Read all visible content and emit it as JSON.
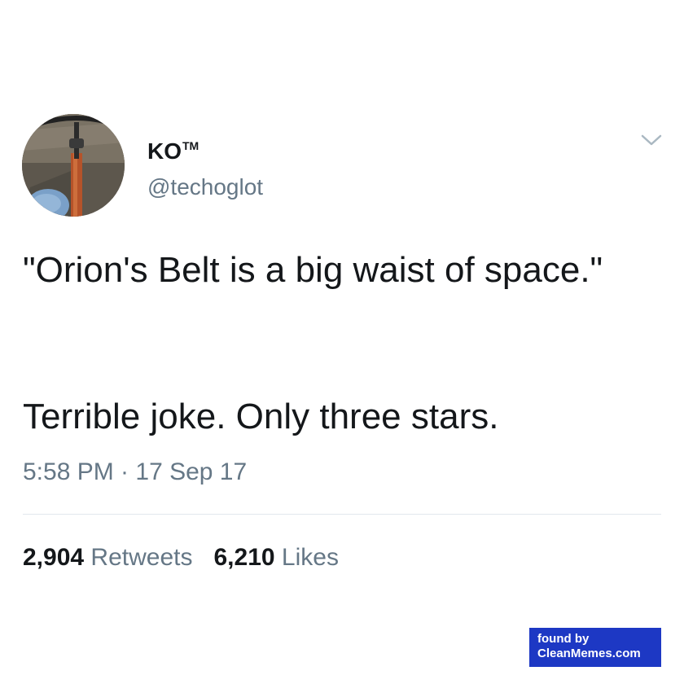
{
  "tweet": {
    "author": {
      "display_name": "KO",
      "trademark": "TM",
      "handle": "@techoglot",
      "avatar_icon": "bicycle-photo-avatar"
    },
    "menu_icon": "chevron-down-icon",
    "text": {
      "line1": "\"Orion's Belt is a big waist of space.\"",
      "line2": "Terrible joke. Only three stars."
    },
    "timestamp": "5:58 PM · 17 Sep 17",
    "stats": {
      "retweets_count": "2,904",
      "retweets_label": "Retweets",
      "likes_count": "6,210",
      "likes_label": "Likes"
    }
  },
  "watermark": {
    "line1": "found by",
    "line2": "CleanMemes.com",
    "background": "#1d38c4"
  },
  "colors": {
    "text_primary": "#14171a",
    "text_secondary": "#657786",
    "divider": "#e1e8ed"
  }
}
